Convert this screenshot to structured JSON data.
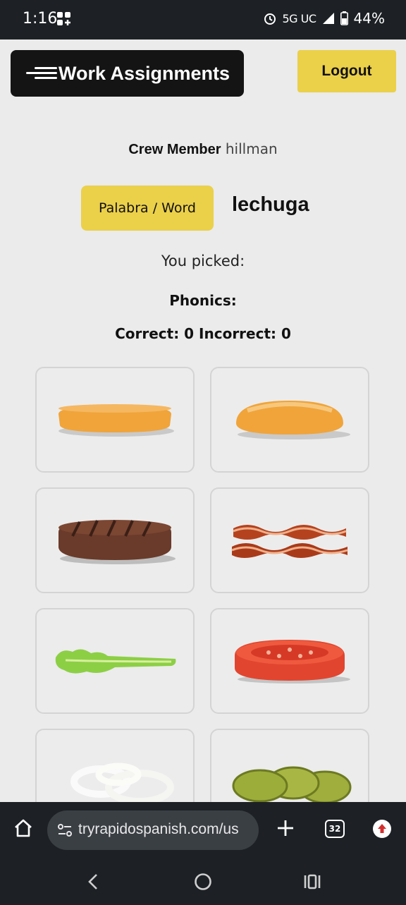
{
  "status_bar": {
    "time": "1:16",
    "network": "5G UC",
    "battery": "44%",
    "icons": [
      "widget-grid-icon",
      "alarm-icon",
      "signal-icon",
      "battery-icon"
    ]
  },
  "header": {
    "menu_title": "Work Assignments",
    "logout_label": "Logout"
  },
  "crew": {
    "label": "Crew Member",
    "name": "hillman"
  },
  "word_section": {
    "button_label": "Palabra / Word",
    "word": "lechuga"
  },
  "picked": {
    "label": "You picked:"
  },
  "phonics": {
    "label": "Phonics:"
  },
  "score": {
    "correct_label": "Correct:",
    "correct_value": "0",
    "incorrect_label": "Incorrect:",
    "incorrect_value": "0"
  },
  "tiles": [
    {
      "item": "bottom-bun"
    },
    {
      "item": "top-bun"
    },
    {
      "item": "beef-patty"
    },
    {
      "item": "bacon"
    },
    {
      "item": "lettuce"
    },
    {
      "item": "tomato"
    },
    {
      "item": "onion"
    },
    {
      "item": "pickles"
    }
  ],
  "browser": {
    "url": "tryrapidospanish.com/us",
    "tab_count": "32"
  },
  "colors": {
    "accent_yellow": "#ebd04a",
    "dark": "#141414",
    "system_bar": "#1d2125",
    "page_bg": "#ebebeb"
  }
}
